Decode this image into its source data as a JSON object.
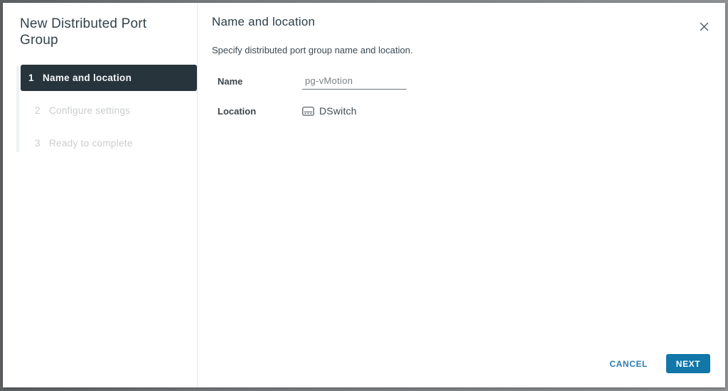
{
  "dialog": {
    "title": "New Distributed Port Group"
  },
  "steps": [
    {
      "number": "1",
      "label": "Name and location"
    },
    {
      "number": "2",
      "label": "Configure settings"
    },
    {
      "number": "3",
      "label": "Ready to complete"
    }
  ],
  "content": {
    "heading": "Name and location",
    "description": "Specify distributed port group name and location.",
    "fields": {
      "name_label": "Name",
      "name_value": "pg-vMotion",
      "location_label": "Location",
      "location_value": "DSwitch",
      "location_icon": "dswitch-icon"
    }
  },
  "footer": {
    "cancel_label": "CANCEL",
    "next_label": "NEXT"
  },
  "colors": {
    "active_step_bg": "#28343c",
    "primary_button_bg": "#1077a8",
    "link_blue": "#2e7cb4"
  }
}
